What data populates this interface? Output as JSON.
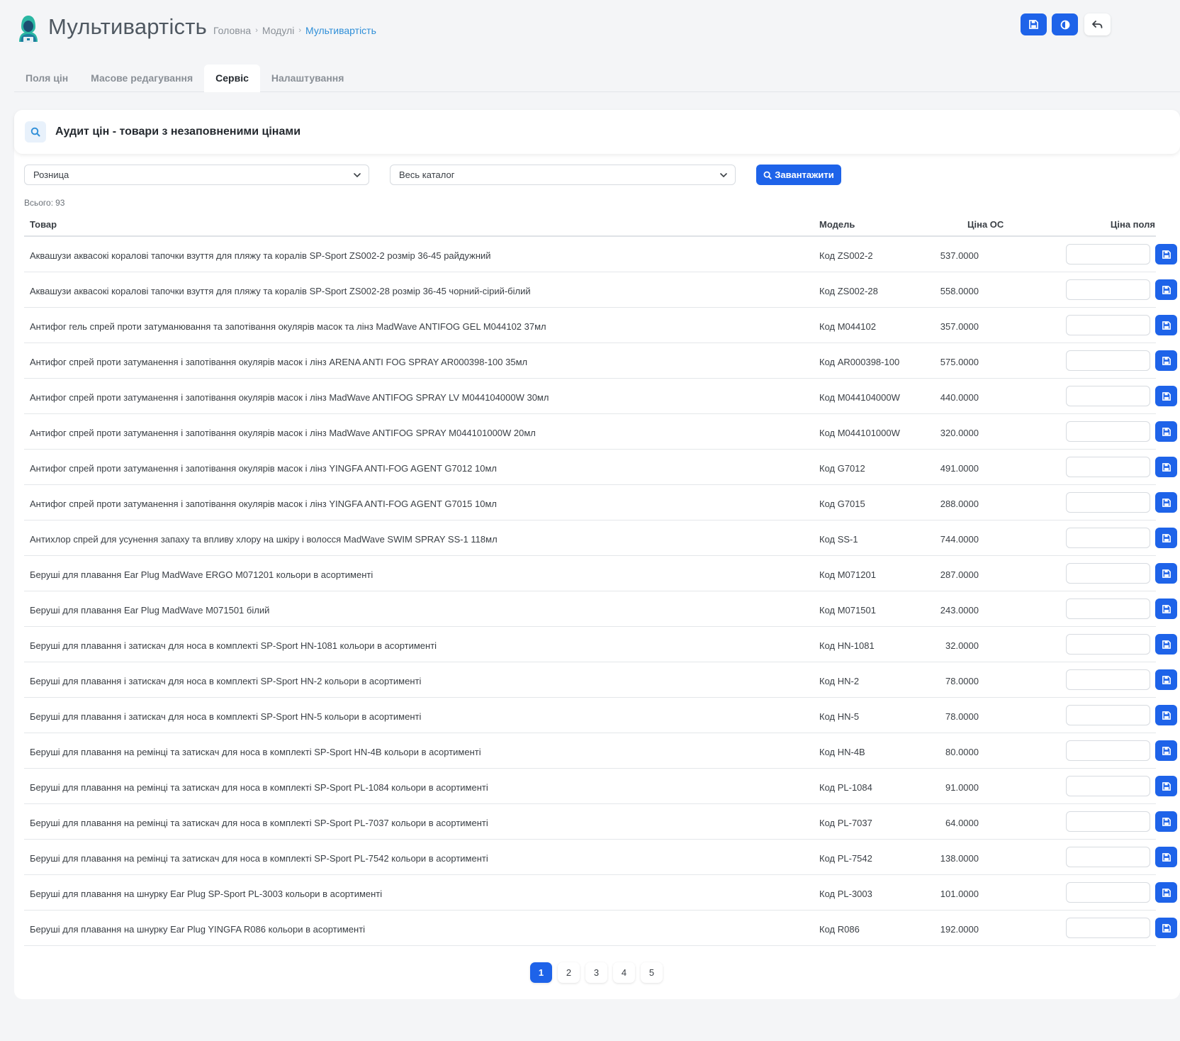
{
  "header": {
    "title": "Мультивартість",
    "breadcrumb": [
      "Головна",
      "Модулі",
      "Мультивартість"
    ],
    "buttons": [
      "save-icon",
      "contrast-icon",
      "back-arrow-icon"
    ]
  },
  "tabs": [
    {
      "label": "Поля цін",
      "active": false
    },
    {
      "label": "Масове редагування",
      "active": false
    },
    {
      "label": "Сервіс",
      "active": true
    },
    {
      "label": "Налаштування",
      "active": false
    }
  ],
  "card": {
    "title": "Аудит цін - товари з незаповненими цінами",
    "icon": "search-icon"
  },
  "filters": {
    "price_type": "Розница",
    "catalog": "Весь каталог",
    "load_label": "Завантажити"
  },
  "total": {
    "label": "Всього:",
    "value": "93"
  },
  "table": {
    "headers": {
      "product": "Товар",
      "model": "Модель",
      "price_os": "Ціна ОС",
      "price_field": "Ціна поля"
    },
    "rows": [
      {
        "name": "Аквашузи аквасокі коралові тапочки взуття для пляжу та коралів SP-Sport ZS002-2 розмір 36-45 райдужний",
        "model": "Код ZS002-2",
        "price": "537.0000"
      },
      {
        "name": "Аквашузи аквасокі коралові тапочки взуття для пляжу та коралів SP-Sport ZS002-28 розмір 36-45 чорний-сірий-білий",
        "model": "Код ZS002-28",
        "price": "558.0000"
      },
      {
        "name": "Антифог гель спрей проти затуманювання та запотівання окулярів масок та лінз MadWave ANTIFOG GEL M044102 37мл",
        "model": "Код M044102",
        "price": "357.0000"
      },
      {
        "name": "Антифог спрей проти затуманення і запотівання окулярів масок і лінз ARENA ANTI FOG SPRAY AR000398-100 35мл",
        "model": "Код AR000398-100",
        "price": "575.0000"
      },
      {
        "name": "Антифог спрей проти затуманення і запотівання окулярів масок і лінз MadWave ANTIFOG SPRAY LV M044104000W 30мл",
        "model": "Код M044104000W",
        "price": "440.0000"
      },
      {
        "name": "Антифог спрей проти затуманення і запотівання окулярів масок і лінз MadWave ANTIFOG SPRAY M044101000W 20мл",
        "model": "Код M044101000W",
        "price": "320.0000"
      },
      {
        "name": "Антифог спрей проти затуманення і запотівання окулярів масок і лінз YINGFA ANTI-FOG AGENT G7012 10мл",
        "model": "Код G7012",
        "price": "491.0000"
      },
      {
        "name": "Антифог спрей проти затуманення і запотівання окулярів масок і лінз YINGFA ANTI-FOG AGENT G7015 10мл",
        "model": "Код G7015",
        "price": "288.0000"
      },
      {
        "name": "Антихлор спрей для усунення запаху та впливу хлору на шкіру і волосся MadWave SWIM SPRAY SS-1 118мл",
        "model": "Код SS-1",
        "price": "744.0000"
      },
      {
        "name": "Беруші для плавання Ear Plug MadWave ERGO M071201 кольори в асортименті",
        "model": "Код M071201",
        "price": "287.0000"
      },
      {
        "name": "Беруші для плавання Ear Plug MadWave M071501 білий",
        "model": "Код M071501",
        "price": "243.0000"
      },
      {
        "name": "Беруші для плавання і затискач для носа в комплекті SP-Sport HN-1081 кольори в асортименті",
        "model": "Код HN-1081",
        "price": "32.0000"
      },
      {
        "name": "Беруші для плавання і затискач для носа в комплекті SP-Sport HN-2 кольори в асортименті",
        "model": "Код HN-2",
        "price": "78.0000"
      },
      {
        "name": "Беруші для плавання і затискач для носа в комплекті SP-Sport HN-5 кольори в асортименті",
        "model": "Код HN-5",
        "price": "78.0000"
      },
      {
        "name": "Беруші для плавання на ремінці та затискач для носа в комплекті SP-Sport HN-4B кольори в асортименті",
        "model": "Код HN-4B",
        "price": "80.0000"
      },
      {
        "name": "Беруші для плавання на ремінці та затискач для носа в комплекті SP-Sport PL-1084 кольори в асортименті",
        "model": "Код PL-1084",
        "price": "91.0000"
      },
      {
        "name": "Беруші для плавання на ремінці та затискач для носа в комплекті SP-Sport PL-7037 кольори в асортименті",
        "model": "Код PL-7037",
        "price": "64.0000"
      },
      {
        "name": "Беруші для плавання на ремінці та затискач для носа в комплекті SP-Sport PL-7542 кольори в асортименті",
        "model": "Код PL-7542",
        "price": "138.0000"
      },
      {
        "name": "Беруші для плавання на шнурку Ear Plug SP-Sport PL-3003 кольори в асортименті",
        "model": "Код PL-3003",
        "price": "101.0000"
      },
      {
        "name": "Беруші для плавання на шнурку Ear Plug YINGFA R086 кольори в асортименті",
        "model": "Код R086",
        "price": "192.0000"
      }
    ]
  },
  "pagination": {
    "pages": [
      "1",
      "2",
      "3",
      "4",
      "5"
    ],
    "current": "1"
  },
  "colors": {
    "accent": "#1e63e9",
    "link": "#2f8fd8",
    "background": "#f4f5f7"
  }
}
